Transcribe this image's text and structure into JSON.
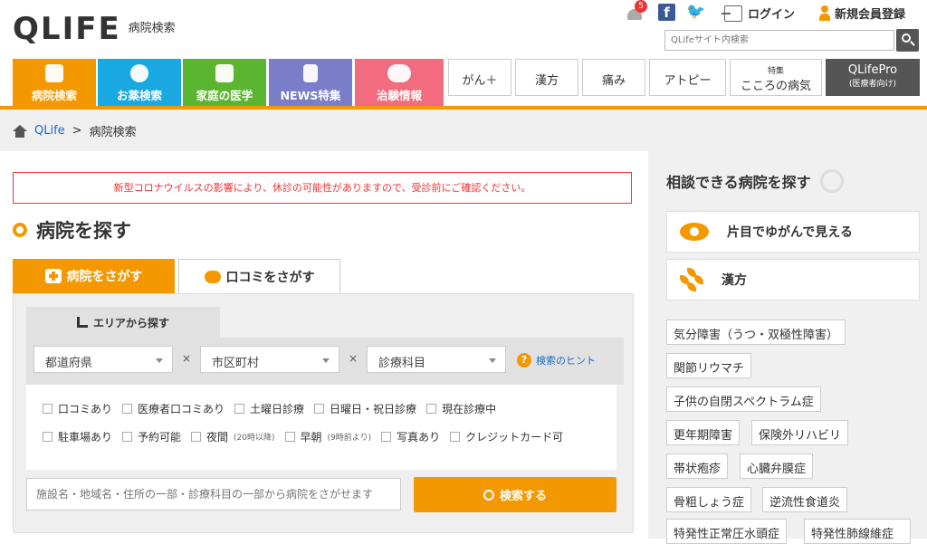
{
  "header": {
    "logo": "QLIFE",
    "logo_sub": "病院検索",
    "notification_count": "5",
    "facebook": "f",
    "login": "ログイン",
    "register": "新規会員登録",
    "search_placeholder": "QLifeサイト内検索"
  },
  "nav": [
    {
      "label": "病院検索",
      "color": "#f39800"
    },
    {
      "label": "お薬検索",
      "color": "#1aa8e0"
    },
    {
      "label": "家庭の医学",
      "color": "#5cb531"
    },
    {
      "label": "NEWS特集",
      "color": "#7a7ec9"
    },
    {
      "label": "治験情報",
      "color": "#f06c7e"
    }
  ],
  "subnav": [
    {
      "label": "がん＋"
    },
    {
      "label": "漢方"
    },
    {
      "label": "痛み"
    },
    {
      "label": "アトピー"
    },
    {
      "top": "特集",
      "label": "こころの病気"
    },
    {
      "label": "QLifePro",
      "sub": "(医療者向け)"
    }
  ],
  "breadcrumb": {
    "home": "QLife",
    "sep": ">",
    "current": "病院検索"
  },
  "main": {
    "alert": "新型コロナウイルスの影響により、休診の可能性がありますので、受診前にご確認ください。",
    "title": "病院を探す",
    "tab_hospital": "病院をさがす",
    "tab_review": "口コミをさがす",
    "area_tab": "エリアから探す",
    "select_pref": "都道府県",
    "select_city": "市区町村",
    "select_dept": "診療科目",
    "times": "×",
    "hint": "検索のヒント",
    "hint_icon": "?",
    "checks_row1": [
      "口コミあり",
      "医療者口コミあり",
      "土曜日診療",
      "日曜日・祝日診療",
      "現在診療中"
    ],
    "checks_row2_a": [
      "駐車場あり",
      "予約可能"
    ],
    "check_night": "夜間",
    "check_night_note": "(20時以降)",
    "check_morning": "早朝",
    "check_morning_note": "(9時前より)",
    "checks_row2_b": [
      "写真あり",
      "クレジットカード可"
    ],
    "keyword_placeholder": "施設名・地域名・住所の一部・診療科目の一部から病院をさがせます",
    "search_button": "検索する"
  },
  "sidebar": {
    "title": "相談できる病院を探す",
    "card1": "片目でゆがんで見える",
    "card2": "漢方",
    "tags": [
      "気分障害（うつ・双極性障害）",
      "関節リウマチ",
      "子供の自閉スペクトラム症",
      "更年期障害",
      "保険外リハビリ",
      "帯状疱疹",
      "心臓弁膜症",
      "骨粗しょう症",
      "逆流性食道炎",
      "特発性正常圧水頭症",
      "特発性肺線維症"
    ]
  }
}
